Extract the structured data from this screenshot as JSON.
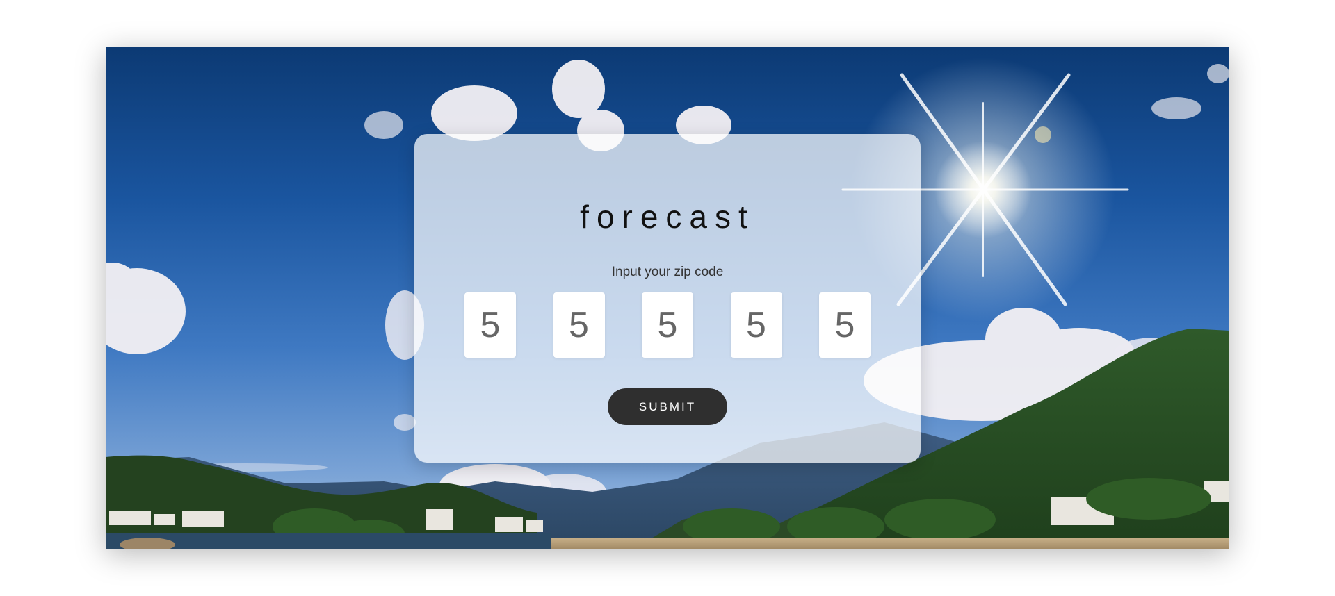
{
  "app": {
    "title": "forecast",
    "prompt": "Input your zip code"
  },
  "zip_inputs": [
    {
      "value": "5"
    },
    {
      "value": "5"
    },
    {
      "value": "5"
    },
    {
      "value": "5"
    },
    {
      "value": "5"
    }
  ],
  "actions": {
    "submit_label": "SUBMIT"
  },
  "colors": {
    "sky_top": "#0c3a74",
    "sky_bottom": "#a9c0de",
    "card_background": "rgba(255,255,255,0.72)",
    "button_background": "#2f2f2f",
    "button_text": "#ffffff",
    "title_text": "#111111"
  },
  "background": {
    "icons": [
      "sun-icon",
      "cloud-icon",
      "mountain-icon",
      "building-icon",
      "tree-icon"
    ]
  }
}
